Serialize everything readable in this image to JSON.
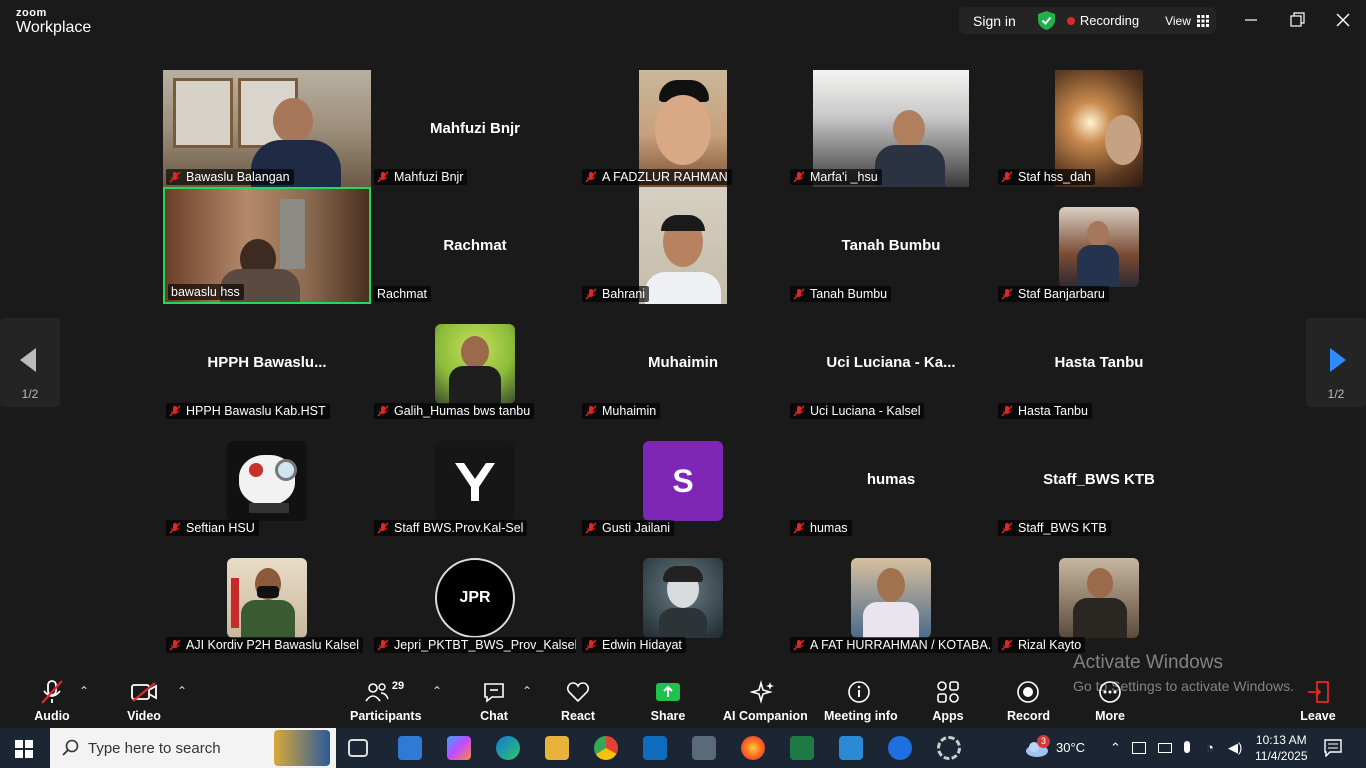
{
  "app": {
    "brand_small": "zoom",
    "brand_large": "Workplace"
  },
  "top": {
    "sign_in": "Sign in",
    "recording": "Recording",
    "view": "View"
  },
  "pagination": {
    "left": "1/2",
    "right": "1/2"
  },
  "participants": [
    {
      "label": "Bawaslu Balangan",
      "display": "",
      "kind": "video",
      "muted": true
    },
    {
      "label": "Mahfuzi Bnjr",
      "display": "Mahfuzi Bnjr",
      "kind": "name",
      "muted": true
    },
    {
      "label": "A FADZLUR RAHMAN",
      "display": "",
      "kind": "video",
      "muted": true
    },
    {
      "label": "Marfa'i _hsu",
      "display": "",
      "kind": "video",
      "muted": true
    },
    {
      "label": "Staf hss_dah",
      "display": "",
      "kind": "video",
      "muted": true
    },
    {
      "label": "bawaslu hss",
      "display": "",
      "kind": "video",
      "muted": false,
      "active": true
    },
    {
      "label": "Rachmat",
      "display": "Rachmat",
      "kind": "name",
      "muted": false
    },
    {
      "label": "Bahrani",
      "display": "",
      "kind": "video",
      "muted": true
    },
    {
      "label": "Tanah Bumbu",
      "display": "Tanah Bumbu",
      "kind": "name",
      "muted": true
    },
    {
      "label": "Staf Banjarbaru",
      "display": "",
      "kind": "avatar",
      "muted": true
    },
    {
      "label": "HPPH Bawaslu Kab.HST",
      "display": "HPPH  Bawaslu...",
      "kind": "name",
      "muted": true
    },
    {
      "label": "Galih_Humas bws tanbu",
      "display": "",
      "kind": "avatar",
      "muted": true
    },
    {
      "label": "Muhaimin",
      "display": "Muhaimin",
      "kind": "name",
      "muted": true
    },
    {
      "label": "Uci Luciana - Kalsel",
      "display": "Uci Luciana - Ka...",
      "kind": "name",
      "muted": true
    },
    {
      "label": "Hasta Tanbu",
      "display": "Hasta Tanbu",
      "kind": "name",
      "muted": true
    },
    {
      "label": "Seftian HSU",
      "display": "",
      "kind": "avatar",
      "muted": true
    },
    {
      "label": "Staff BWS.Prov.Kal-Sel",
      "display": "",
      "kind": "avatar",
      "muted": true
    },
    {
      "label": "Gusti Jailani",
      "display": "",
      "kind": "avatar",
      "muted": true,
      "initial": "S"
    },
    {
      "label": "humas",
      "display": "humas",
      "kind": "name",
      "muted": true
    },
    {
      "label": "Staff_BWS KTB",
      "display": "Staff_BWS KTB",
      "kind": "name",
      "muted": true
    },
    {
      "label": "AJI Kordiv P2H Bawaslu Kalsel",
      "display": "",
      "kind": "avatar",
      "muted": true
    },
    {
      "label": "Jepri_PKTBT_BWS_Prov_Kalsel",
      "display": "",
      "kind": "avatar",
      "muted": true,
      "initial": "JPR"
    },
    {
      "label": "Edwin Hidayat",
      "display": "",
      "kind": "avatar",
      "muted": true
    },
    {
      "label": "A FAT HURRAHMAN / KOTABA...",
      "display": "",
      "kind": "avatar",
      "muted": true
    },
    {
      "label": "Rizal Kayto",
      "display": "",
      "kind": "avatar",
      "muted": true
    }
  ],
  "toolbar": {
    "audio": "Audio",
    "video": "Video",
    "participants": "Participants",
    "participants_count": "29",
    "chat": "Chat",
    "react": "React",
    "share": "Share",
    "ai_companion": "AI Companion",
    "meeting_info": "Meeting info",
    "apps": "Apps",
    "record": "Record",
    "more": "More",
    "leave": "Leave"
  },
  "watermark": {
    "line1": "Activate Windows",
    "line2": "Go to Settings to activate Windows."
  },
  "taskbar": {
    "search_placeholder": "Type here to search",
    "weather_badge": "3",
    "temperature": "30°C",
    "time": "10:13 AM",
    "date": "11/4/2025"
  },
  "colors": {
    "accent_green": "#23d959",
    "share_green": "#1fc34b",
    "rec_red": "#e02828",
    "avatar_purple": "#7e26b5"
  }
}
